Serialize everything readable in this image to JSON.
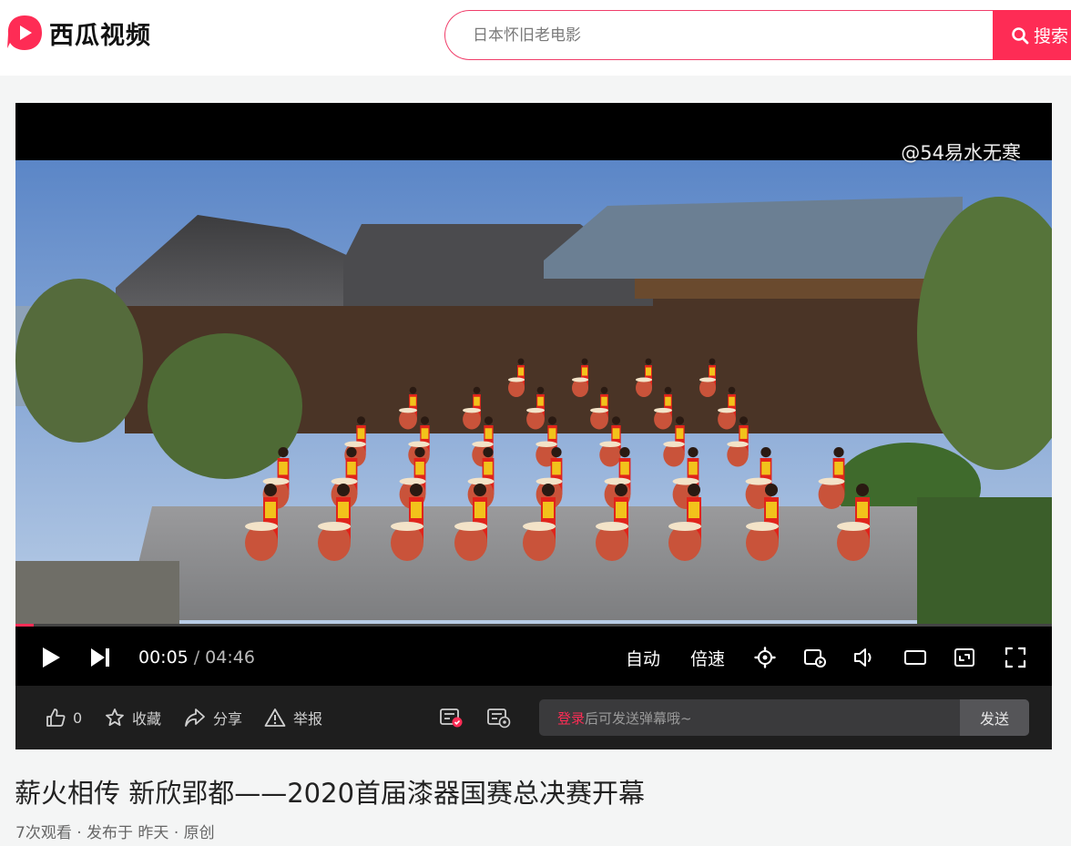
{
  "header": {
    "logo_text": "西瓜视频",
    "search_placeholder": "日本怀旧老电影",
    "search_button": "搜索"
  },
  "player": {
    "watermark": "@54易水无寒",
    "progress": 0.018,
    "current_time": "00:05",
    "separator": "/",
    "duration": "04:46",
    "auto_label": "自动",
    "speed_label": "倍速"
  },
  "actions": {
    "like_count": "0",
    "favorite_label": "收藏",
    "share_label": "分享",
    "report_label": "举报",
    "danmaku_login": "登录",
    "danmaku_hint": "后可发送弹幕哦~",
    "send_label": "发送"
  },
  "video": {
    "title": "薪火相传 新欣郢都——2020首届漆器国赛总决赛开幕",
    "meta": "7次观看 · 发布于 昨天 · 原创"
  },
  "colors": {
    "brand": "#fe2c55",
    "player_bg": "#000000",
    "action_bar_bg": "#1e1e1e"
  }
}
